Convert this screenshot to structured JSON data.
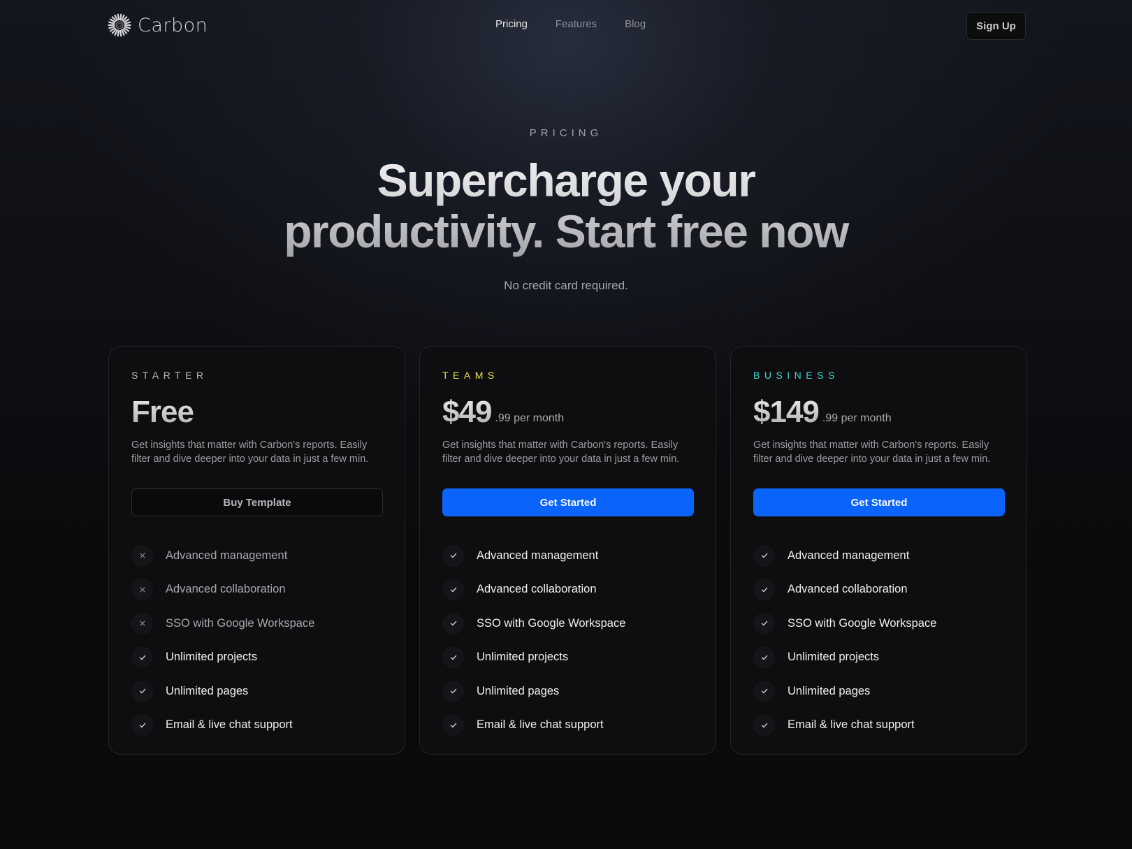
{
  "brand": {
    "name": "Carbon",
    "logo_icon": "radial-burst-icon"
  },
  "nav": {
    "links": [
      {
        "label": "Pricing",
        "active": true
      },
      {
        "label": "Features",
        "active": false
      },
      {
        "label": "Blog",
        "active": false
      }
    ],
    "signup_label": "Sign Up"
  },
  "hero": {
    "eyebrow": "PRICING",
    "headline_line1": "Supercharge your",
    "headline_line2": "productivity. Start free now",
    "subline": "No credit card required."
  },
  "colors": {
    "accent_primary": "#0a63fb",
    "teams_tier": "#dfe043",
    "business_tier": "#3fd4cc",
    "background": "#0a0a0c"
  },
  "plans": [
    {
      "tier": "STARTER",
      "price": "Free",
      "price_suffix": "",
      "description": "Get insights that matter with Carbon's reports. Easily filter and dive deeper into your data in just a few min.",
      "cta": "Buy Template",
      "features": [
        {
          "label": "Advanced management",
          "included": false
        },
        {
          "label": "Advanced collaboration",
          "included": false
        },
        {
          "label": "SSO with Google Workspace",
          "included": false
        },
        {
          "label": "Unlimited projects",
          "included": true
        },
        {
          "label": "Unlimited pages",
          "included": true
        },
        {
          "label": "Email & live chat support",
          "included": true
        }
      ]
    },
    {
      "tier": "TEAMS",
      "price": "$49",
      "price_suffix": ".99 per month",
      "description": "Get insights that matter with Carbon's reports. Easily filter and dive deeper into your data in just a few min.",
      "cta": "Get Started",
      "features": [
        {
          "label": "Advanced management",
          "included": true
        },
        {
          "label": "Advanced collaboration",
          "included": true
        },
        {
          "label": "SSO with Google Workspace",
          "included": true
        },
        {
          "label": "Unlimited projects",
          "included": true
        },
        {
          "label": "Unlimited pages",
          "included": true
        },
        {
          "label": "Email & live chat support",
          "included": true
        }
      ]
    },
    {
      "tier": "BUSINESS",
      "price": "$149",
      "price_suffix": ".99 per month",
      "description": "Get insights that matter with Carbon's reports. Easily filter and dive deeper into your data in just a few min.",
      "cta": "Get Started",
      "features": [
        {
          "label": "Advanced management",
          "included": true
        },
        {
          "label": "Advanced collaboration",
          "included": true
        },
        {
          "label": "SSO with Google Workspace",
          "included": true
        },
        {
          "label": "Unlimited projects",
          "included": true
        },
        {
          "label": "Unlimited pages",
          "included": true
        },
        {
          "label": "Email & live chat support",
          "included": true
        }
      ]
    }
  ]
}
